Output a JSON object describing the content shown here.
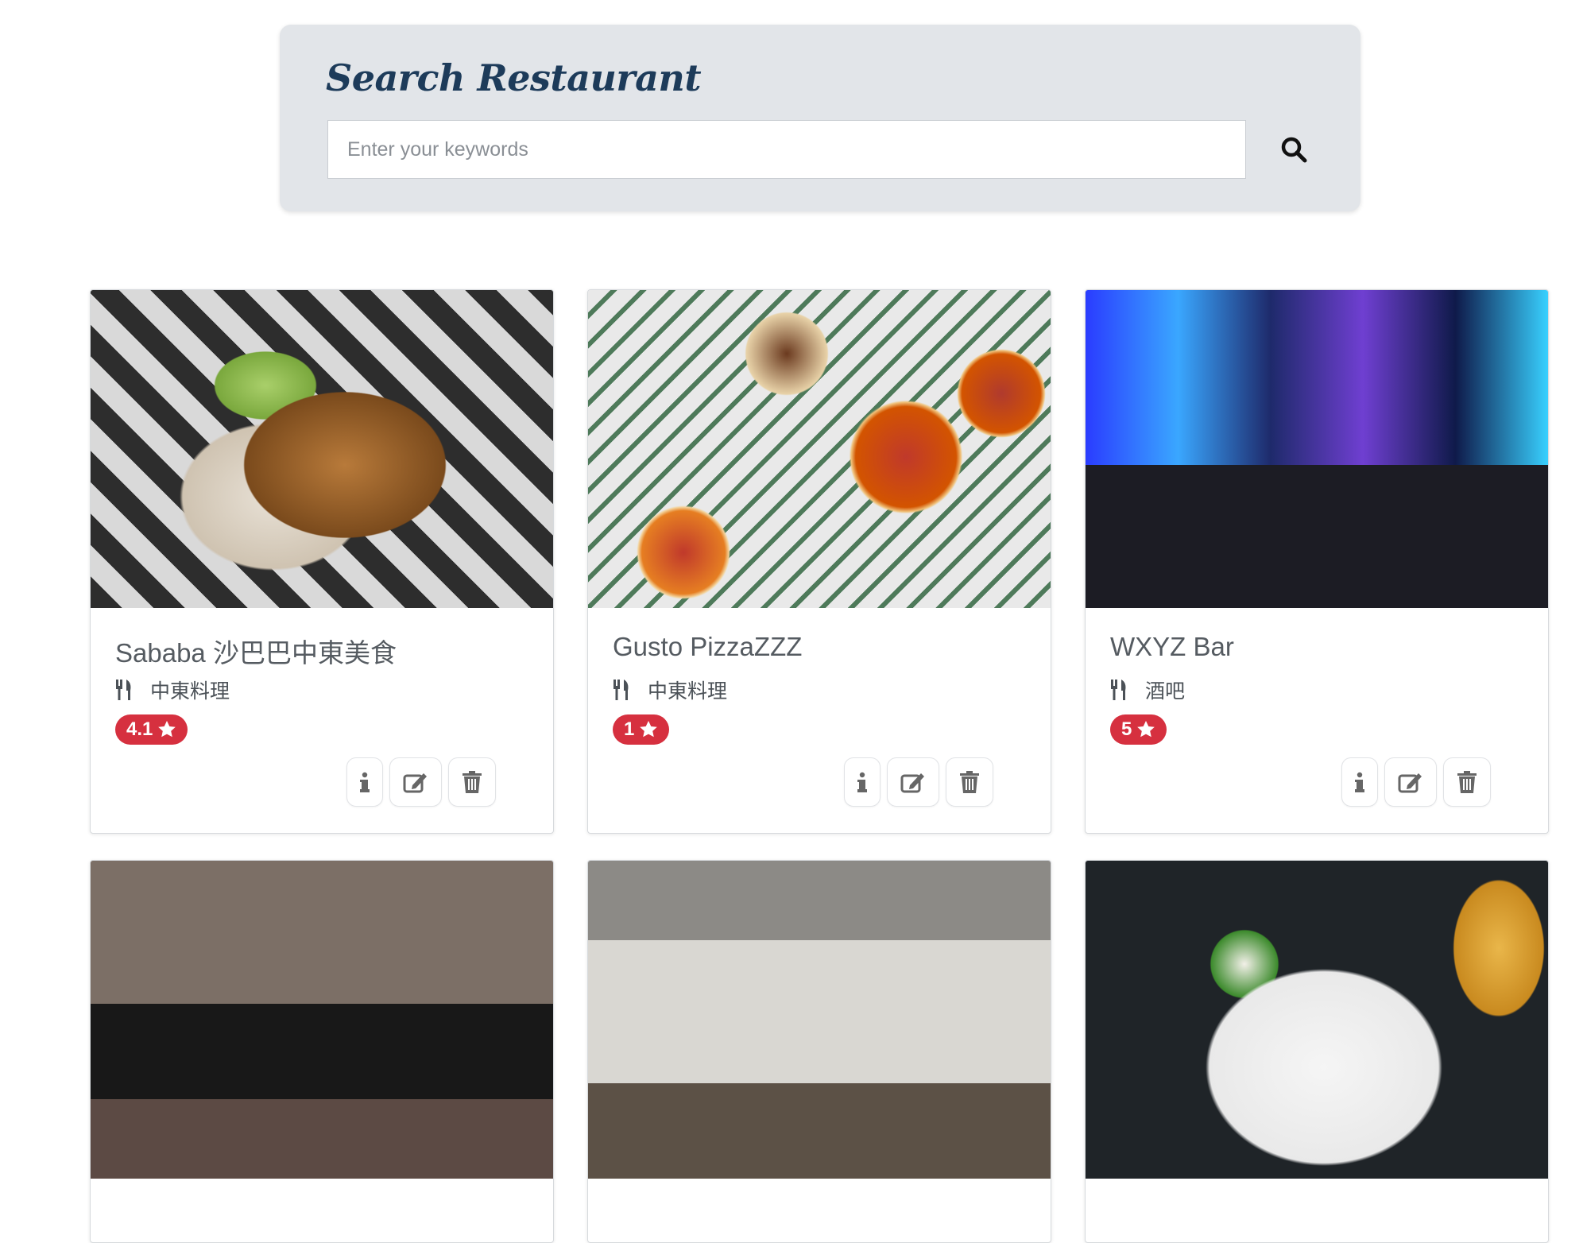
{
  "search": {
    "title": "Search Restaurant",
    "placeholder": "Enter your keywords",
    "value": "",
    "icon": "search-icon"
  },
  "restaurants": [
    {
      "name": "Sababa 沙巴巴中東美食",
      "category": "中東料理",
      "rating": "4.1",
      "image": "pita-wrap-photo"
    },
    {
      "name": "Gusto PizzaZZZ",
      "category": "中東料理",
      "rating": "1",
      "image": "pizza-spread-photo"
    },
    {
      "name": "WXYZ Bar",
      "category": "酒吧",
      "rating": "5",
      "image": "neon-bar-interior-photo"
    },
    {
      "image": "umeko-storefront-photo"
    },
    {
      "image": "cafe-interior-photo"
    },
    {
      "image": "brunch-plate-photo"
    }
  ],
  "icons": {
    "category": "utensils-icon",
    "rating": "star-icon",
    "info": "info-icon",
    "edit": "edit-icon",
    "delete": "trash-icon"
  },
  "colors": {
    "title": "#1d3b5a",
    "rating_badge": "#d6303f",
    "panel_bg": "#e2e5e9"
  }
}
